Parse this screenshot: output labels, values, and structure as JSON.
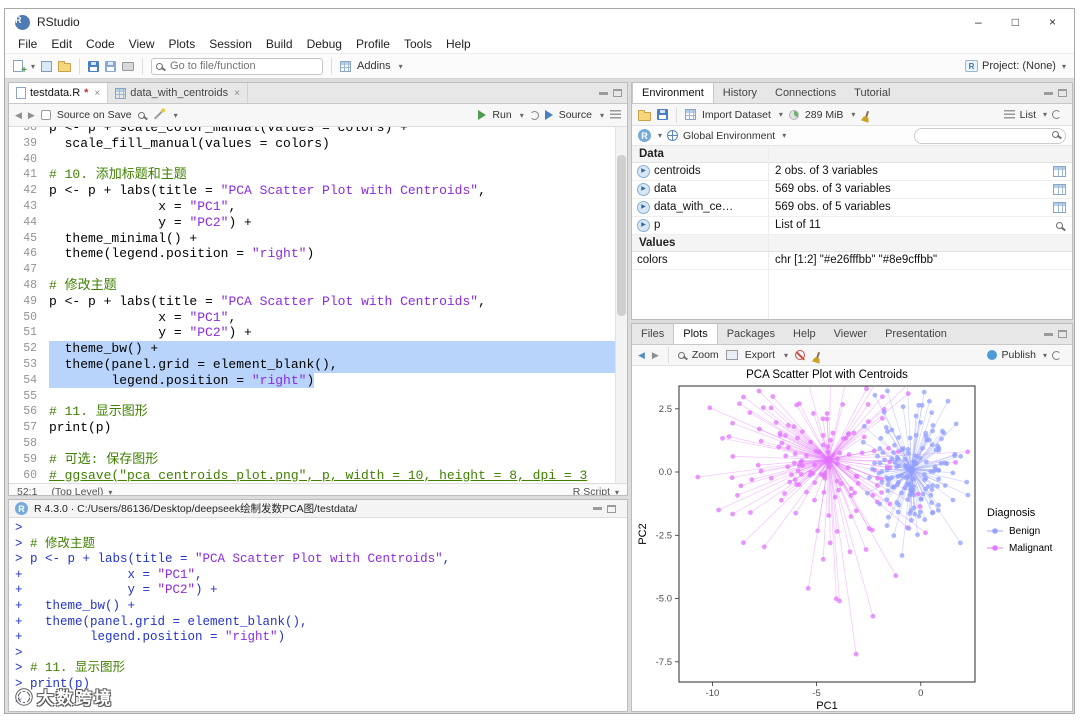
{
  "ui": {
    "caret": "▾",
    "back": "◀",
    "forward": "▶",
    "close": "×",
    "expander": "▶",
    "r_logo": "R"
  },
  "window": {
    "title": "RStudio",
    "minimize": "–",
    "maximize": "□",
    "close": "×"
  },
  "menu_items": [
    "File",
    "Edit",
    "Code",
    "View",
    "Plots",
    "Session",
    "Build",
    "Debug",
    "Profile",
    "Tools",
    "Help"
  ],
  "main_toolbar": {
    "goto_placeholder": "Go to file/function",
    "addins": "Addins",
    "project": "Project: (None)"
  },
  "source_pane": {
    "tabs": [
      {
        "label": "testdata.R",
        "dirty": true
      },
      {
        "label": "data_with_centroids",
        "dirty": false
      }
    ],
    "toolbar": {
      "source_on_save": "Source on Save",
      "run": "Run",
      "source": "Source"
    },
    "status_left": "52:1",
    "status_scope": "(Top Level)",
    "status_type": "R Script",
    "first_line_number": 38,
    "selection": {
      "full_lines": [
        52,
        53
      ],
      "partial_lines": [
        54
      ]
    },
    "underline_lines": [
      60
    ],
    "code_lines": [
      "p <- p + scale_color_manual(values = colors) +",
      "  scale_fill_manual(values = colors)",
      "",
      "# 10. 添加标题和主题",
      "p <- p + labs(title = \"PCA Scatter Plot with Centroids\",",
      "              x = \"PC1\",",
      "              y = \"PC2\") +",
      "  theme_minimal() +",
      "  theme(legend.position = \"right\")",
      "",
      "# 修改主题",
      "p <- p + labs(title = \"PCA Scatter Plot with Centroids\",",
      "              x = \"PC1\",",
      "              y = \"PC2\") +",
      "  theme_bw() +",
      "  theme(panel.grid = element_blank(),",
      "        legend.position = \"right\")",
      "",
      "# 11. 显示图形",
      "print(p)",
      "",
      "# 可选: 保存图形",
      "# ggsave(\"pca_centroids_plot.png\", p, width = 10, height = 8, dpi = 3"
    ]
  },
  "console_pane": {
    "title": "R 4.3.0 · C:/Users/86136/Desktop/deepseek绘制发数PCA图/testdata/",
    "lines": [
      ">",
      "> # 修改主题",
      "> p <- p + labs(title = \"PCA Scatter Plot with Centroids\",",
      "+              x = \"PC1\",",
      "+              y = \"PC2\") +",
      "+   theme_bw() +",
      "+   theme(panel.grid = element_blank(),",
      "+         legend.position = \"right\")",
      ">",
      "> # 11. 显示图形",
      "> print(p)",
      ">"
    ]
  },
  "environment_pane": {
    "tabs": [
      "Environment",
      "History",
      "Connections",
      "Tutorial"
    ],
    "import_dataset": "Import Dataset",
    "memory": "289 MiB",
    "list_label": "List",
    "lang": "R",
    "scope": "Global Environment",
    "sections": [
      {
        "header": "Data",
        "rows": [
          {
            "name": "centroids",
            "value": "2 obs. of 3 variables",
            "expand": true,
            "action": "table"
          },
          {
            "name": "data",
            "value": "569 obs. of 3 variables",
            "expand": true,
            "action": "table"
          },
          {
            "name": "data_with_ce…",
            "value": "569 obs. of 5 variables",
            "expand": true,
            "action": "table"
          },
          {
            "name": "p",
            "value": "List of 11",
            "expand": true,
            "action": "magnifier"
          }
        ]
      },
      {
        "header": "Values",
        "rows": [
          {
            "name": "colors",
            "value": "chr [1:2] \"#e26fffbb\" \"#8e9cffbb\"",
            "expand": false,
            "action": ""
          }
        ]
      }
    ]
  },
  "plots_pane": {
    "tabs": [
      "Files",
      "Plots",
      "Packages",
      "Help",
      "Viewer",
      "Presentation"
    ],
    "zoom": "Zoom",
    "export": "Export",
    "publish": "Publish"
  },
  "watermark": "大数跨境",
  "chart_data": {
    "type": "scatter",
    "title": "PCA Scatter Plot with Centroids",
    "xlabel": "PC1",
    "ylabel": "PC2",
    "xlim": [
      -11.6,
      2.6
    ],
    "ylim": [
      -8.3,
      3.4
    ],
    "xticks": [
      -10,
      -5,
      0
    ],
    "yticks": [
      2.5,
      0.0,
      -2.5,
      -5.0,
      -7.5
    ],
    "grid": false,
    "legend_title": "Diagnosis",
    "legend_position": "right",
    "seed": 7,
    "series": [
      {
        "name": "Malignant",
        "color": "#e26fff",
        "alpha": 0.73,
        "n": 150,
        "centroid": [
          -4.4,
          0.5
        ],
        "sd": [
          2.2,
          1.75
        ],
        "outliers": [
          [
            -3.1,
            -7.2
          ],
          [
            -2.3,
            -5.7
          ],
          [
            -3.9,
            -5.1
          ],
          [
            -5.4,
            -4.6
          ],
          [
            -1.2,
            -4.1
          ],
          [
            -9.7,
            -1.5
          ],
          [
            -10.7,
            -0.2
          ],
          [
            -9.2,
            1.4
          ],
          [
            -8.7,
            2.7
          ],
          [
            -0.6,
            3.1
          ]
        ]
      },
      {
        "name": "Benign",
        "color": "#8e9cff",
        "alpha": 0.73,
        "n": 150,
        "centroid": [
          -0.45,
          0.1
        ],
        "sd": [
          1.05,
          1.25
        ],
        "outliers": [
          [
            1.9,
            -2.8
          ],
          [
            2.2,
            -0.4
          ],
          [
            1.3,
            2.8
          ],
          [
            -0.9,
            -3.3
          ],
          [
            1.7,
            1.9
          ]
        ]
      }
    ]
  }
}
